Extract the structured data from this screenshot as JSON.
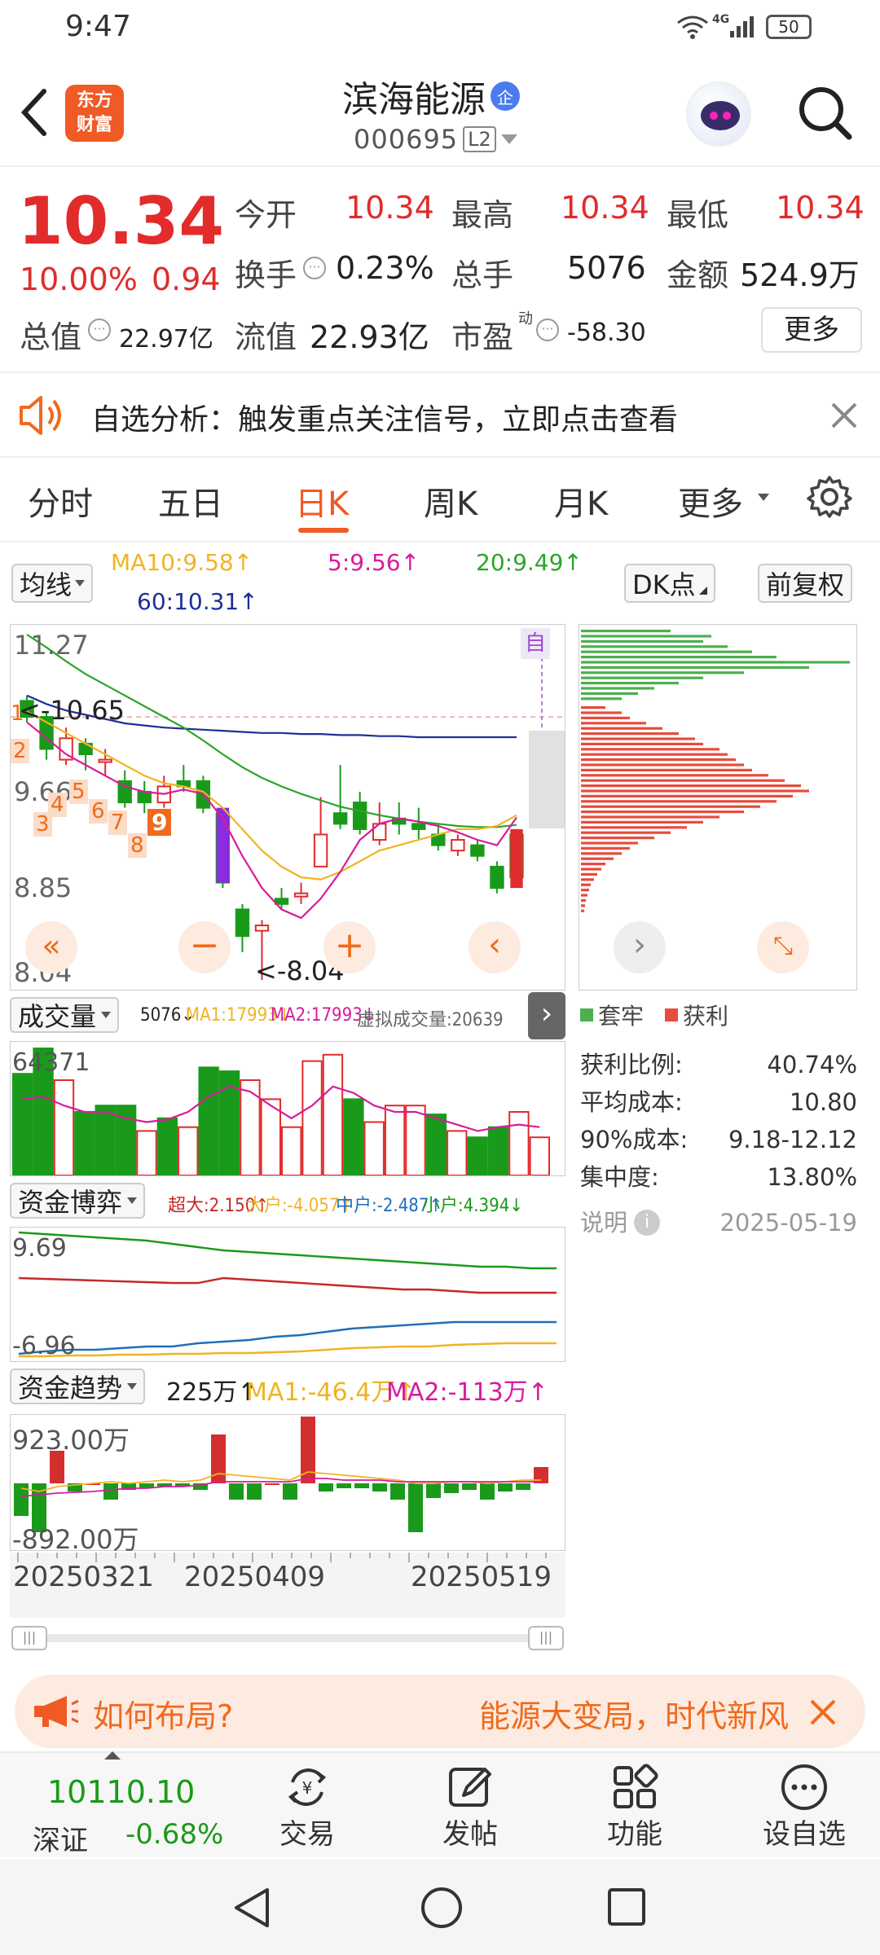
{
  "status_bar": {
    "time": "9:47",
    "network": "4G",
    "battery": "50"
  },
  "header": {
    "app_logo_line1": "东方",
    "app_logo_line2": "财富",
    "stock_name": "滨海能源",
    "badge": "企",
    "stock_code": "000695",
    "level": "L2"
  },
  "quote": {
    "price": "10.34",
    "change_pct": "10.00%",
    "change": "0.94",
    "open_label": "今开",
    "open": "10.34",
    "high_label": "最高",
    "high": "10.34",
    "low_label": "最低",
    "low": "10.34",
    "turnover_label": "换手",
    "turnover": "0.23%",
    "volume_label": "总手",
    "volume": "5076",
    "amount_label": "金额",
    "amount": "524.9万",
    "mktcap_label": "总值",
    "mktcap": "22.97亿",
    "float_label": "流值",
    "float": "22.93亿",
    "pe_label": "市盈",
    "pe_sup": "动",
    "pe": "-58.30",
    "more_label": "更多"
  },
  "banner": {
    "text": "自选分析：触发重点关注信号，立即点击查看"
  },
  "tabs": [
    {
      "label": "分时",
      "active": false
    },
    {
      "label": "五日",
      "active": false
    },
    {
      "label": "日K",
      "active": true
    },
    {
      "label": "周K",
      "active": false
    },
    {
      "label": "月K",
      "active": false
    },
    {
      "label": "更多",
      "active": false
    }
  ],
  "ma_bar": {
    "selector": "均线",
    "ma10": "MA10:9.58↑",
    "ma5": "5:9.56↑",
    "ma20": "20:9.49↑",
    "ma60": "60:10.31↑",
    "dk": "DK点",
    "adjust": "前复权"
  },
  "kchart": {
    "y_top": "11.27",
    "y_mid": "9.66",
    "y_low": "8.85",
    "y_bottom": "8.04",
    "max_label": "<-10.65",
    "min_label": "<-8.04",
    "self_badge": "自",
    "seq_numbers": [
      "1",
      "2",
      "3",
      "4",
      "5",
      "6",
      "7",
      "8",
      "9"
    ],
    "colors": {
      "up": "#e22b2b",
      "down": "#1a9a1a",
      "ma5": "#d81b9c",
      "ma10": "#f0b323",
      "ma20": "#2aa52a",
      "ma60": "#1e2f98"
    }
  },
  "chip_panel": {
    "legend_trapped": "套牢",
    "legend_profit": "获利",
    "profit_ratio_label": "获利比例:",
    "profit_ratio": "40.74%",
    "avg_cost_label": "平均成本:",
    "avg_cost": "10.80",
    "cost90_label": "90%成本:",
    "cost90": "9.18-12.12",
    "concentration_label": "集中度:",
    "concentration": "13.80%",
    "note_label": "说明",
    "date": "2025-05-19"
  },
  "volume_panel": {
    "selector": "成交量",
    "vol": "5076↓",
    "ma1": "MA1:17993↓",
    "ma2": "MA2:17993↓",
    "virtual": "虚拟成交量:20639",
    "y_top": "64371"
  },
  "fund_game": {
    "selector": "资金博弈",
    "super": "超大:2.150↑",
    "large": "大户:-4.057↑",
    "mid": "中户:-2.487↑",
    "small": "小户:4.394↓",
    "y_top": "9.69",
    "y_bottom": "-6.96"
  },
  "fund_trend": {
    "selector": "资金趋势",
    "value": "225万↑",
    "ma1": "MA1:-46.4万↑",
    "ma2": "MA2:-113万↑",
    "y_top": "923.00万",
    "y_bottom": "-892.00万"
  },
  "x_dates": [
    "20250321",
    "20250409",
    "20250519"
  ],
  "promo": {
    "left": "如何布局?",
    "right": "能源大变局，时代新风"
  },
  "bottom_nav": {
    "index_value": "10110.10",
    "index_name": "深证",
    "index_change": "-0.68%",
    "items": [
      "交易",
      "发帖",
      "功能",
      "设自选"
    ]
  }
}
